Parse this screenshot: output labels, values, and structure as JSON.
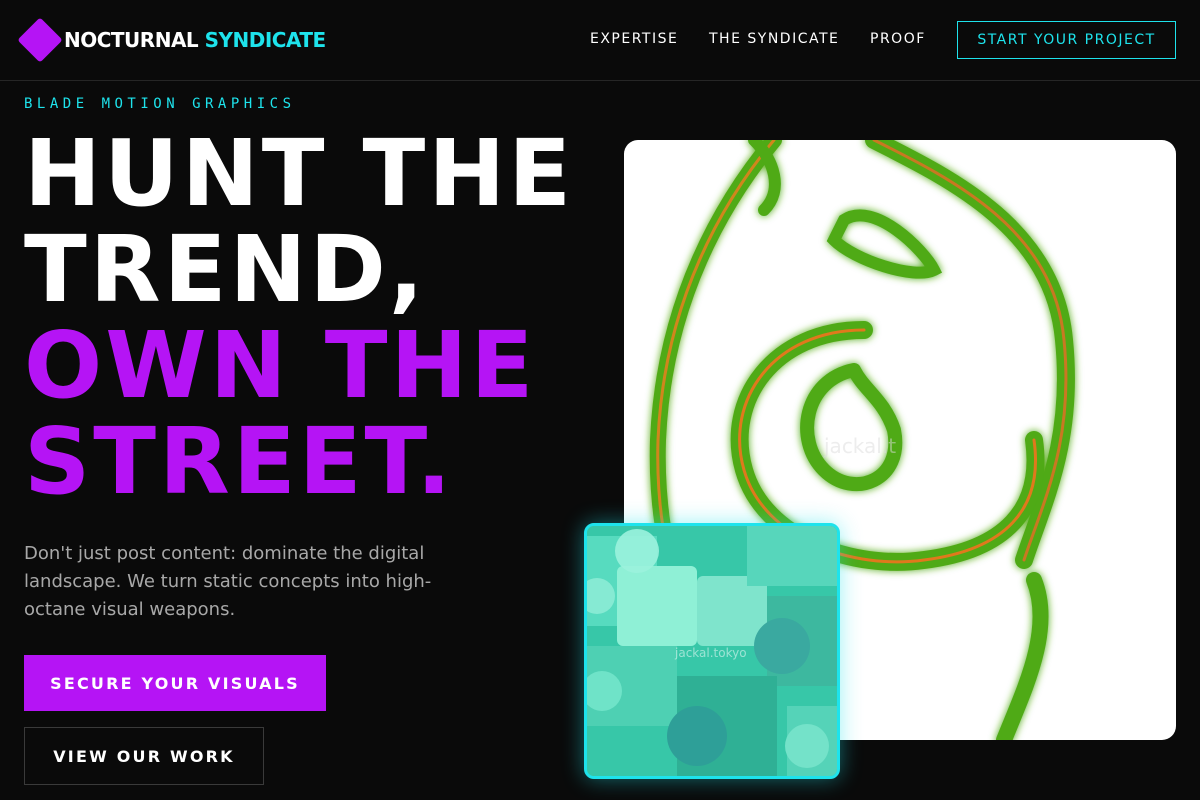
{
  "brand": {
    "name_primary": "NOCTURNAL",
    "name_accent": "SYNDICATE",
    "accent_color": "#1ee3ec",
    "brand_color": "#b514f5"
  },
  "nav": {
    "links": [
      "EXPERTISE",
      "THE SYNDICATE",
      "PROOF"
    ],
    "cta": "START YOUR PROJECT"
  },
  "hero": {
    "eyebrow": "BLADE MOTION GRAPHICS",
    "headline_white": [
      "HUNT THE",
      "TREND,"
    ],
    "headline_purple": [
      "OWN THE",
      "STREET."
    ],
    "subcopy": "Don't just post content: dominate the digital landscape. We turn static concepts into high-octane visual weapons.",
    "primary_button": "SECURE YOUR VISUALS",
    "secondary_button": "VIEW OUR WORK"
  },
  "media": {
    "main_watermark": "jackal.t",
    "inset_watermark": "jackal.tokyo"
  }
}
